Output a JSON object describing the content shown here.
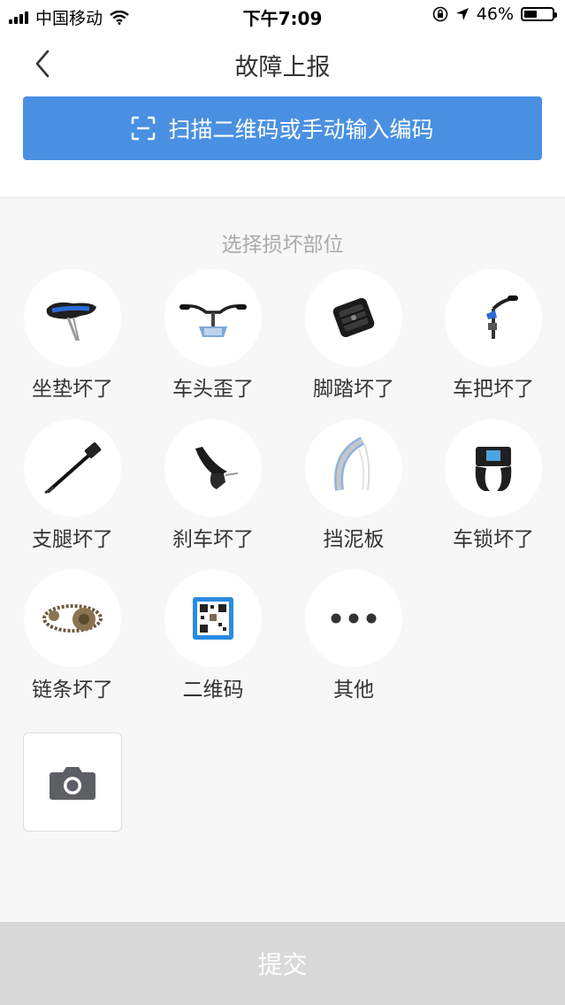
{
  "status_bar": {
    "carrier": "中国移动",
    "time": "下午7:09",
    "battery": "46%",
    "battery_level": 0.46
  },
  "header": {
    "title": "故障上报"
  },
  "scan": {
    "label": "扫描二维码或手动输入编码",
    "color": "#4a90e2"
  },
  "section": {
    "title": "选择损坏部位"
  },
  "parts": [
    {
      "label": "坐垫坏了",
      "icon": "bike-seat-icon"
    },
    {
      "label": "车头歪了",
      "icon": "handlebar-icon"
    },
    {
      "label": "脚踏坏了",
      "icon": "pedal-icon"
    },
    {
      "label": "车把坏了",
      "icon": "bike-handle-icon"
    },
    {
      "label": "支腿坏了",
      "icon": "kickstand-icon"
    },
    {
      "label": "刹车坏了",
      "icon": "brake-lever-icon"
    },
    {
      "label": "挡泥板",
      "icon": "fender-icon"
    },
    {
      "label": "车锁坏了",
      "icon": "bike-lock-icon"
    },
    {
      "label": "链条坏了",
      "icon": "chain-icon"
    },
    {
      "label": "二维码",
      "icon": "qr-code-icon"
    },
    {
      "label": "其他",
      "icon": "more-icon"
    }
  ],
  "photo": {
    "icon": "camera-icon"
  },
  "submit": {
    "label": "提交",
    "color": "#d9d9d9"
  }
}
